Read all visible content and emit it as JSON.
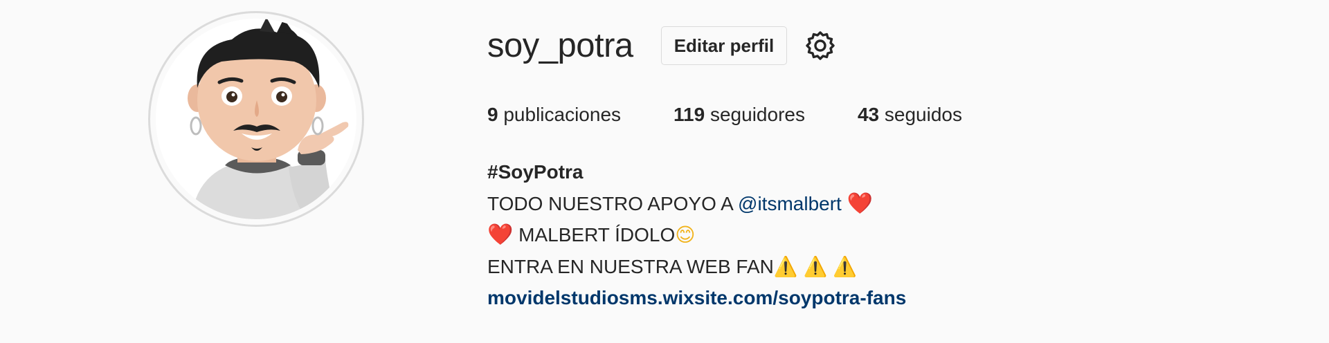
{
  "profile": {
    "username": "soy_potra",
    "edit_button_label": "Editar perfil",
    "settings_icon": "gear-icon"
  },
  "stats": {
    "posts_count": "9",
    "posts_label": "publicaciones",
    "followers_count": "119",
    "followers_label": "seguidores",
    "following_count": "43",
    "following_label": "seguidos"
  },
  "bio": {
    "name": "#SoyPotra",
    "line1_text": "TODO NUESTRO APOYO A ",
    "line1_mention": "@itsmalbert",
    "line1_emoji": "❤️",
    "line2_emoji": "❤️",
    "line2_text": " MALBERT ÍDOLO",
    "line2_smile": "😊",
    "line3_text": "ENTRA EN NUESTRA WEB FAN",
    "line3_warnings": "⚠️ ⚠️ ⚠️",
    "website": "movidelstudiosms.wixsite.com/soypotra-fans"
  },
  "colors": {
    "background": "#fafafa",
    "text": "#262626",
    "link": "#00376b",
    "border": "#dbdbdb"
  }
}
